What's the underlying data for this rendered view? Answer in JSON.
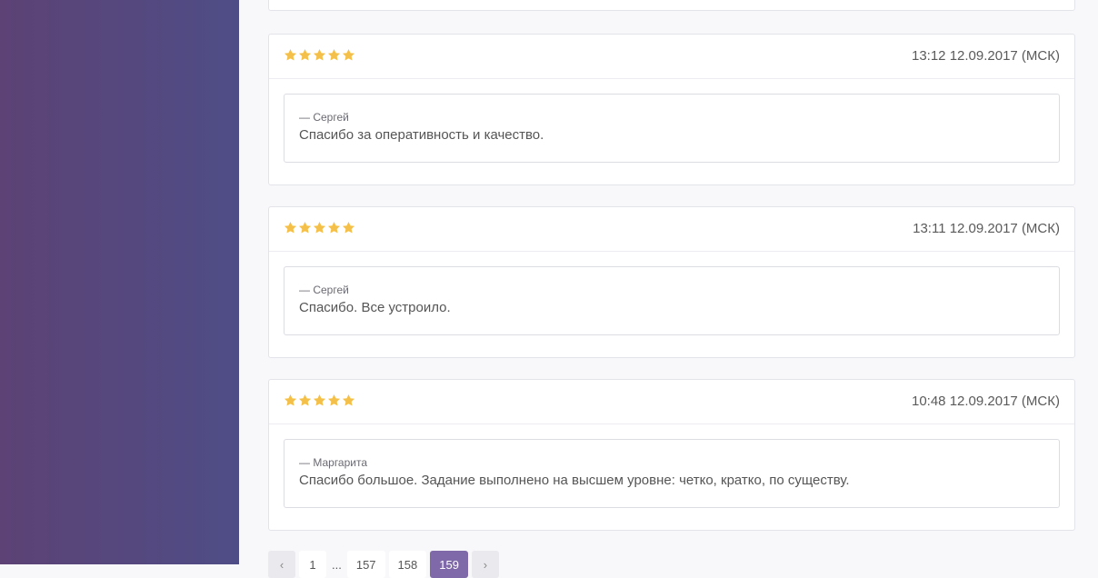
{
  "colors": {
    "sidebar_start": "#5c4275",
    "sidebar_end": "#4f4d86",
    "star": "#f5c04a",
    "pager_active": "#8069a8"
  },
  "reviews": [
    {
      "rating": 5,
      "datetime": "13:12 12.09.2017 (МСК)",
      "author": "— Сергей",
      "text": "Спасибо за оперативность и качество."
    },
    {
      "rating": 5,
      "datetime": "13:11 12.09.2017 (МСК)",
      "author": "— Сергей",
      "text": "Спасибо. Все устроило."
    },
    {
      "rating": 5,
      "datetime": "10:48 12.09.2017 (МСК)",
      "author": "— Маргарита",
      "text": "Спасибо большое. Задание выполнено на высшем уровне: четко, кратко, по существу."
    }
  ],
  "pagination": {
    "prev_icon": "chevron-left-icon",
    "prev_glyph": "‹",
    "first": "1",
    "ellipsis": "...",
    "pages": [
      "157",
      "158"
    ],
    "current": "159",
    "next_icon": "chevron-right-icon",
    "next_glyph": "›"
  }
}
